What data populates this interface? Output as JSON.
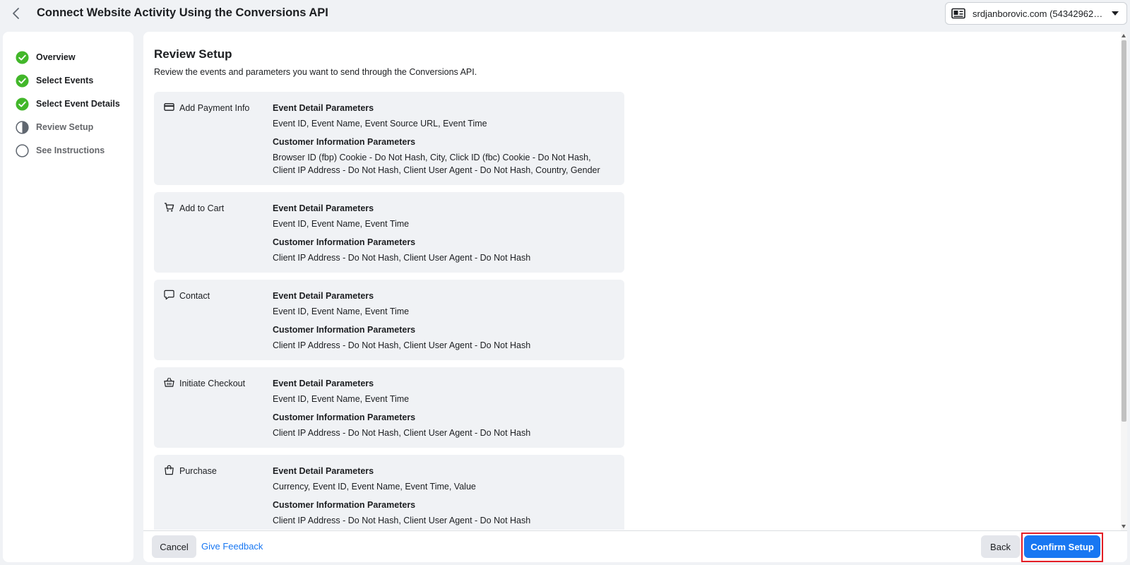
{
  "header": {
    "title": "Connect Website Activity Using the Conversions API",
    "account": "srdjanborovic.com (5434296263…"
  },
  "steps": [
    {
      "label": "Overview",
      "state": "done"
    },
    {
      "label": "Select Events",
      "state": "done"
    },
    {
      "label": "Select Event Details",
      "state": "done"
    },
    {
      "label": "Review Setup",
      "state": "current"
    },
    {
      "label": "See Instructions",
      "state": "todo"
    }
  ],
  "main": {
    "title": "Review Setup",
    "description": "Review the events and parameters you want to send through the Conversions API.",
    "event_detail_heading": "Event Detail Parameters",
    "customer_info_heading": "Customer Information Parameters",
    "events": [
      {
        "name": "Add Payment Info",
        "icon": "credit-card-icon",
        "event_details": "Event ID, Event Name, Event Source URL, Event Time",
        "customer_info": "Browser ID (fbp) Cookie - Do Not Hash, City, Click ID (fbc) Cookie - Do Not Hash, Client IP Address - Do Not Hash, Client User Agent - Do Not Hash, Country, Gender"
      },
      {
        "name": "Add to Cart",
        "icon": "cart-icon",
        "event_details": "Event ID, Event Name, Event Time",
        "customer_info": "Client IP Address - Do Not Hash, Client User Agent - Do Not Hash"
      },
      {
        "name": "Contact",
        "icon": "chat-bubble-icon",
        "event_details": "Event ID, Event Name, Event Time",
        "customer_info": "Client IP Address - Do Not Hash, Client User Agent - Do Not Hash"
      },
      {
        "name": "Initiate Checkout",
        "icon": "basket-icon",
        "event_details": "Event ID, Event Name, Event Time",
        "customer_info": "Client IP Address - Do Not Hash, Client User Agent - Do Not Hash"
      },
      {
        "name": "Purchase",
        "icon": "shopping-bag-icon",
        "event_details": "Currency, Event ID, Event Name, Event Time, Value",
        "customer_info": "Client IP Address - Do Not Hash, Client User Agent - Do Not Hash"
      }
    ]
  },
  "footer": {
    "cancel": "Cancel",
    "feedback": "Give Feedback",
    "back": "Back",
    "confirm": "Confirm Setup"
  },
  "colors": {
    "accent": "#1877f2",
    "step_done": "#42b72a",
    "highlight": "#e41e26"
  }
}
